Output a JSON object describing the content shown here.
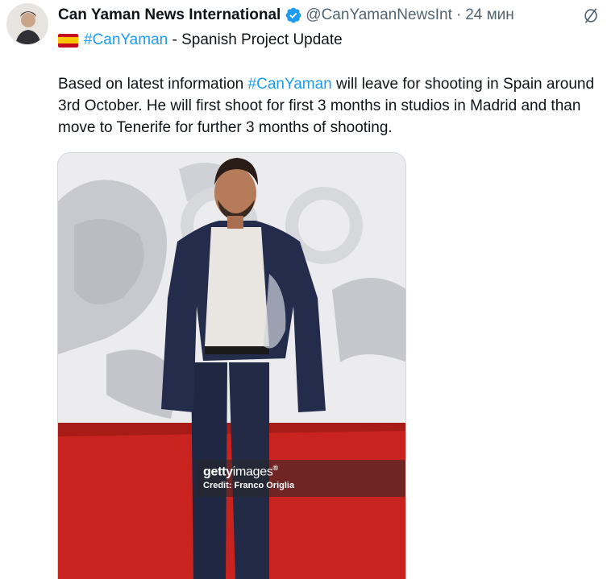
{
  "tweet": {
    "author": {
      "display_name": "Can Yaman News International",
      "handle": "@CanYamanNewsInt",
      "separator": "·",
      "time": "24 мин",
      "avatar_icon": "avatar-photo",
      "verified_icon": "verified-badge-icon",
      "verified_color": "#1d9bf0"
    },
    "subtitle": {
      "flag_icon": "spain-flag-icon",
      "hashtag": "#CanYaman",
      "text": " - Spanish Project Update"
    },
    "body": {
      "part1": "Based on latest information ",
      "hashtag": "#CanYaman",
      "part2": " will leave for shooting in Spain around 3rd October. He will first shoot for first 3 months in studios in Madrid and than move to Tenerife for further 3 months of shooting."
    },
    "media": {
      "watermark_brand_bold": "getty",
      "watermark_brand_light": "images",
      "watermark_mark": "®",
      "credit": "Credit: Franco Origlia"
    },
    "more_icon": "grok-slash-icon",
    "colors": {
      "link": "#1d9bf0",
      "secondary": "#536471",
      "carpet": "#c8231f"
    }
  }
}
